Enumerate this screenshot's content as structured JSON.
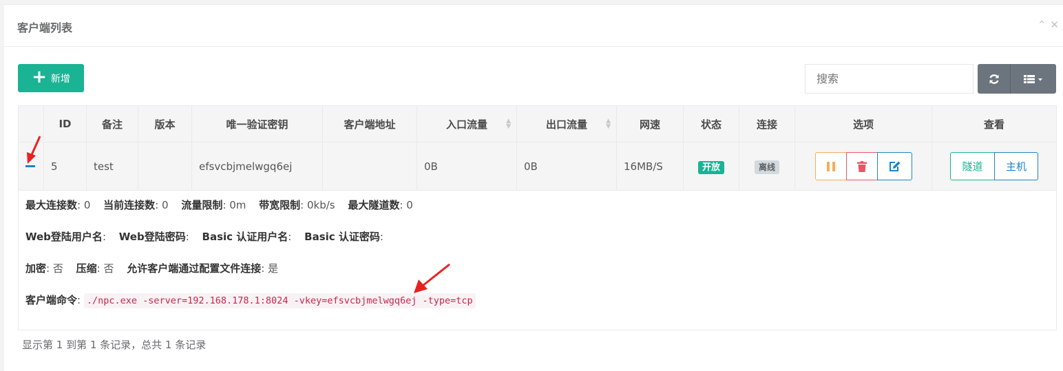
{
  "panel": {
    "title": "客户端列表"
  },
  "toolbar": {
    "add_label": "新增",
    "search_placeholder": "搜索"
  },
  "table": {
    "headers": [
      "",
      "ID",
      "备注",
      "版本",
      "唯一验证密钥",
      "客户端地址",
      "入口流量",
      "出口流量",
      "网速",
      "状态",
      "连接",
      "选项",
      "查看"
    ],
    "row": {
      "id": "5",
      "remark": "test",
      "version": "",
      "vkey": "efsvcbjmelwgq6ej",
      "address": "",
      "in_flow": "0B",
      "out_flow": "0B",
      "rate": "16MB/S",
      "status": "开放",
      "conn": "离线",
      "view_tunnel": "隧道",
      "view_host": "主机"
    },
    "detail": {
      "max_conn_label": "最大连接数",
      "max_conn": "0",
      "cur_conn_label": "当前连接数",
      "cur_conn": "0",
      "flow_limit_label": "流量限制",
      "flow_limit": "0m",
      "rate_limit_label": "带宽限制",
      "rate_limit": "0kb/s",
      "max_tunnel_label": "最大隧道数",
      "max_tunnel": "0",
      "web_user_label": "Web登陆用户名",
      "web_pass_label": "Web登陆密码",
      "basic_user_label": "Basic 认证用户名",
      "basic_pass_label": "Basic 认证密码",
      "crypt_label": "加密",
      "crypt": "否",
      "compress_label": "压缩",
      "compress": "否",
      "config_conn_label": "允许客户端通过配置文件连接",
      "config_conn": "是",
      "cmd_label": "客户端命令",
      "cmd": "./npc.exe -server=192.168.178.1:8024 -vkey=efsvcbjmelwgq6ej -type=tcp"
    }
  },
  "footer": {
    "summary": "显示第 1 到第 1 条记录，总共 1 条记录"
  },
  "colors": {
    "primary": "#1ab394",
    "info": "#1c84c6",
    "warning": "#f8ac59",
    "danger": "#ed5565",
    "annotation": "#e8231f"
  }
}
